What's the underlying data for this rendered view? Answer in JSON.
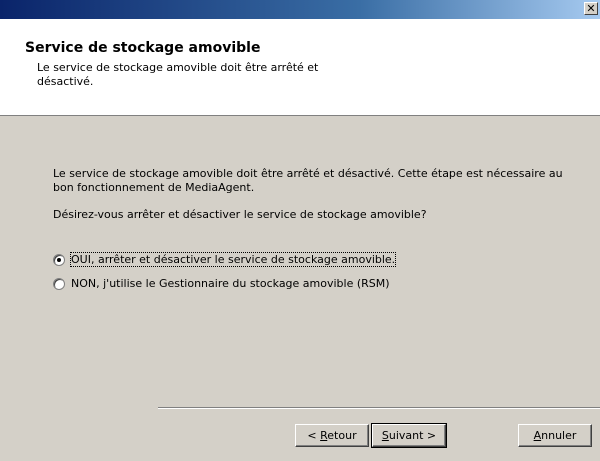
{
  "window": {
    "close_symbol": "✕",
    "close_icon": "close-icon"
  },
  "header": {
    "title": "Service de stockage amovible",
    "subtitle": "Le service de stockage amovible doit être arrêté et désactivé."
  },
  "content": {
    "line1": "Le service de stockage amovible doit être arrêté et désactivé. Cette étape est nécessaire au",
    "line2": "bon fonctionnement de MediaAgent.",
    "question": "Désirez-vous arrêter et désactiver le service de stockage amovible?",
    "options": [
      {
        "label": "OUI, arrêter et désactiver le service de stockage amovible.",
        "selected": true
      },
      {
        "label": "NON, j'utilise le Gestionnaire du stockage amovible (RSM)",
        "selected": false
      }
    ]
  },
  "buttons": {
    "back_prefix": "< ",
    "back_key": "R",
    "back_rest": "etour",
    "next_key": "S",
    "next_rest": "uivant >",
    "cancel_key": "A",
    "cancel_rest": "nnuler"
  }
}
